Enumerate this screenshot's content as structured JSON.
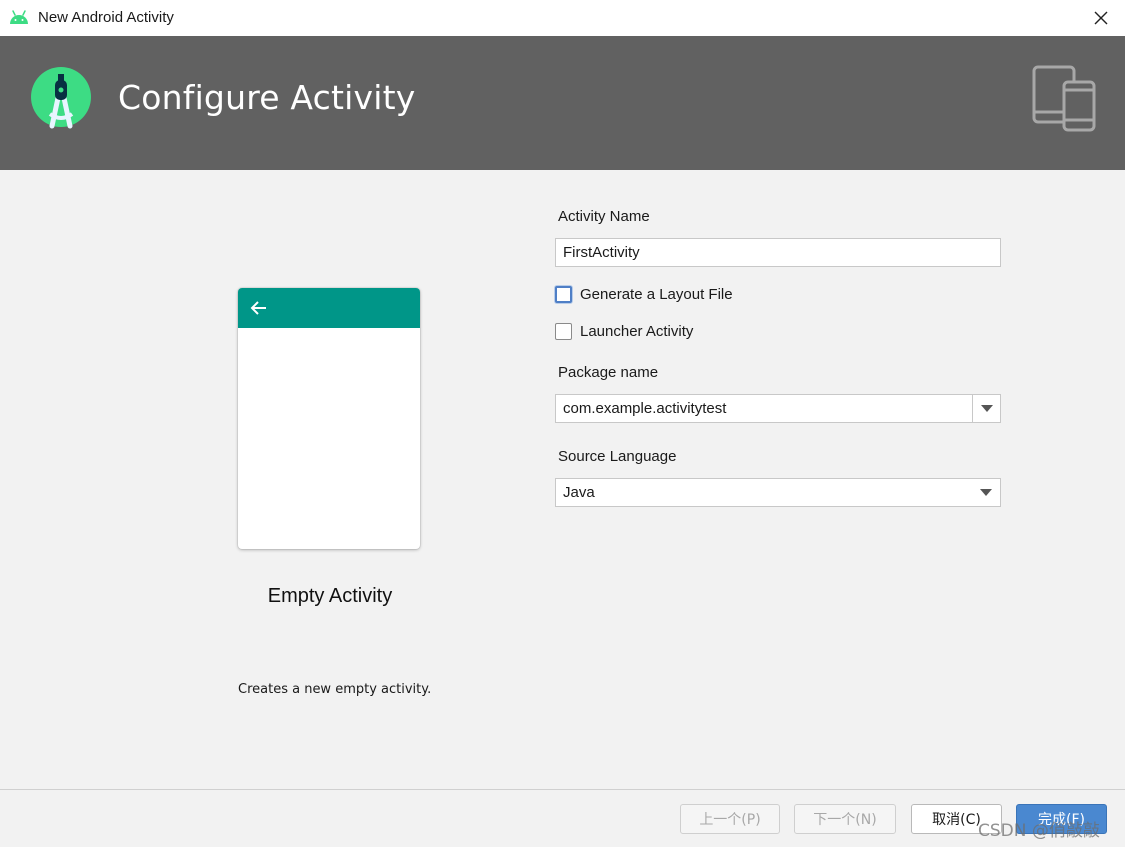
{
  "window": {
    "title": "New Android Activity",
    "icons": {
      "app": "android-robot-icon",
      "close": "close-icon"
    }
  },
  "header": {
    "title": "Configure Activity",
    "icons": {
      "logo": "android-studio-logo",
      "devices": "devices-icon"
    },
    "colors": {
      "background": "#616161"
    }
  },
  "preview": {
    "template_name": "Empty Activity",
    "description": "Creates a new empty activity.",
    "appbar_color": "#009688",
    "icons": {
      "back": "back-arrow-icon"
    }
  },
  "form": {
    "activity_name": {
      "label": "Activity Name",
      "value": "FirstActivity"
    },
    "generate_layout": {
      "label": "Generate a Layout File",
      "checked": false
    },
    "launcher_activity": {
      "label": "Launcher Activity",
      "checked": false
    },
    "package_name": {
      "label": "Package name",
      "value": "com.example.activitytest"
    },
    "source_language": {
      "label": "Source Language",
      "value": "Java"
    }
  },
  "footer": {
    "previous_label": "上一个(P)",
    "next_label": "下一个(N)",
    "cancel_label": "取消(C)",
    "finish_label": "完成(F)",
    "primary_color": "#4a88d0"
  },
  "watermark": "CSDN @俏敲敲"
}
